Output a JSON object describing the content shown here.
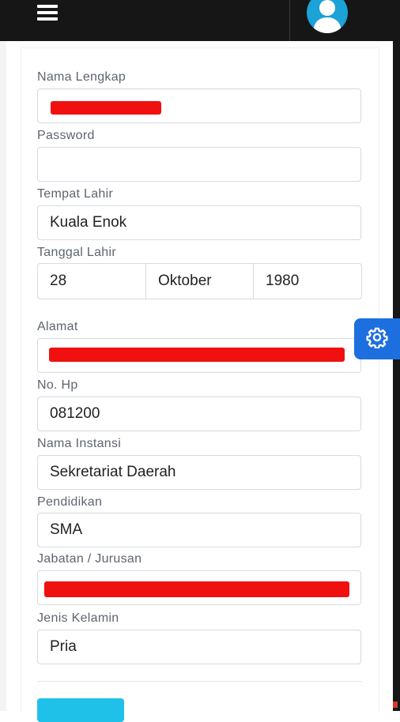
{
  "header": {
    "menu_icon": "hamburger-menu-icon",
    "avatar_icon": "user-avatar-icon"
  },
  "form": {
    "nama_lengkap": {
      "label": "Nama Lengkap"
    },
    "password": {
      "label": "Password",
      "value": ""
    },
    "tempat_lahir": {
      "label": "Tempat Lahir",
      "value": "Kuala Enok"
    },
    "tanggal_lahir": {
      "label": "Tanggal Lahir",
      "day": "28",
      "month": "Oktober",
      "year": "1980"
    },
    "alamat": {
      "label": "Alamat"
    },
    "no_hp": {
      "label": "No. Hp",
      "value": "081200"
    },
    "nama_instansi": {
      "label": "Nama Instansi",
      "value": "Sekretariat Daerah"
    },
    "pendidikan": {
      "label": "Pendidikan",
      "value": "SMA"
    },
    "jabatan": {
      "label": "Jabatan / Jurusan"
    },
    "jenis_kelamin": {
      "label": "Jenis Kelamin",
      "value": "Pria"
    }
  },
  "settings_icon": "gear-icon",
  "colors": {
    "topbar": "#161616",
    "accent_blue": "#1d6fe0",
    "avatar": "#1ba2d6",
    "submit": "#1fc1e8",
    "redaction": "#f01010"
  }
}
